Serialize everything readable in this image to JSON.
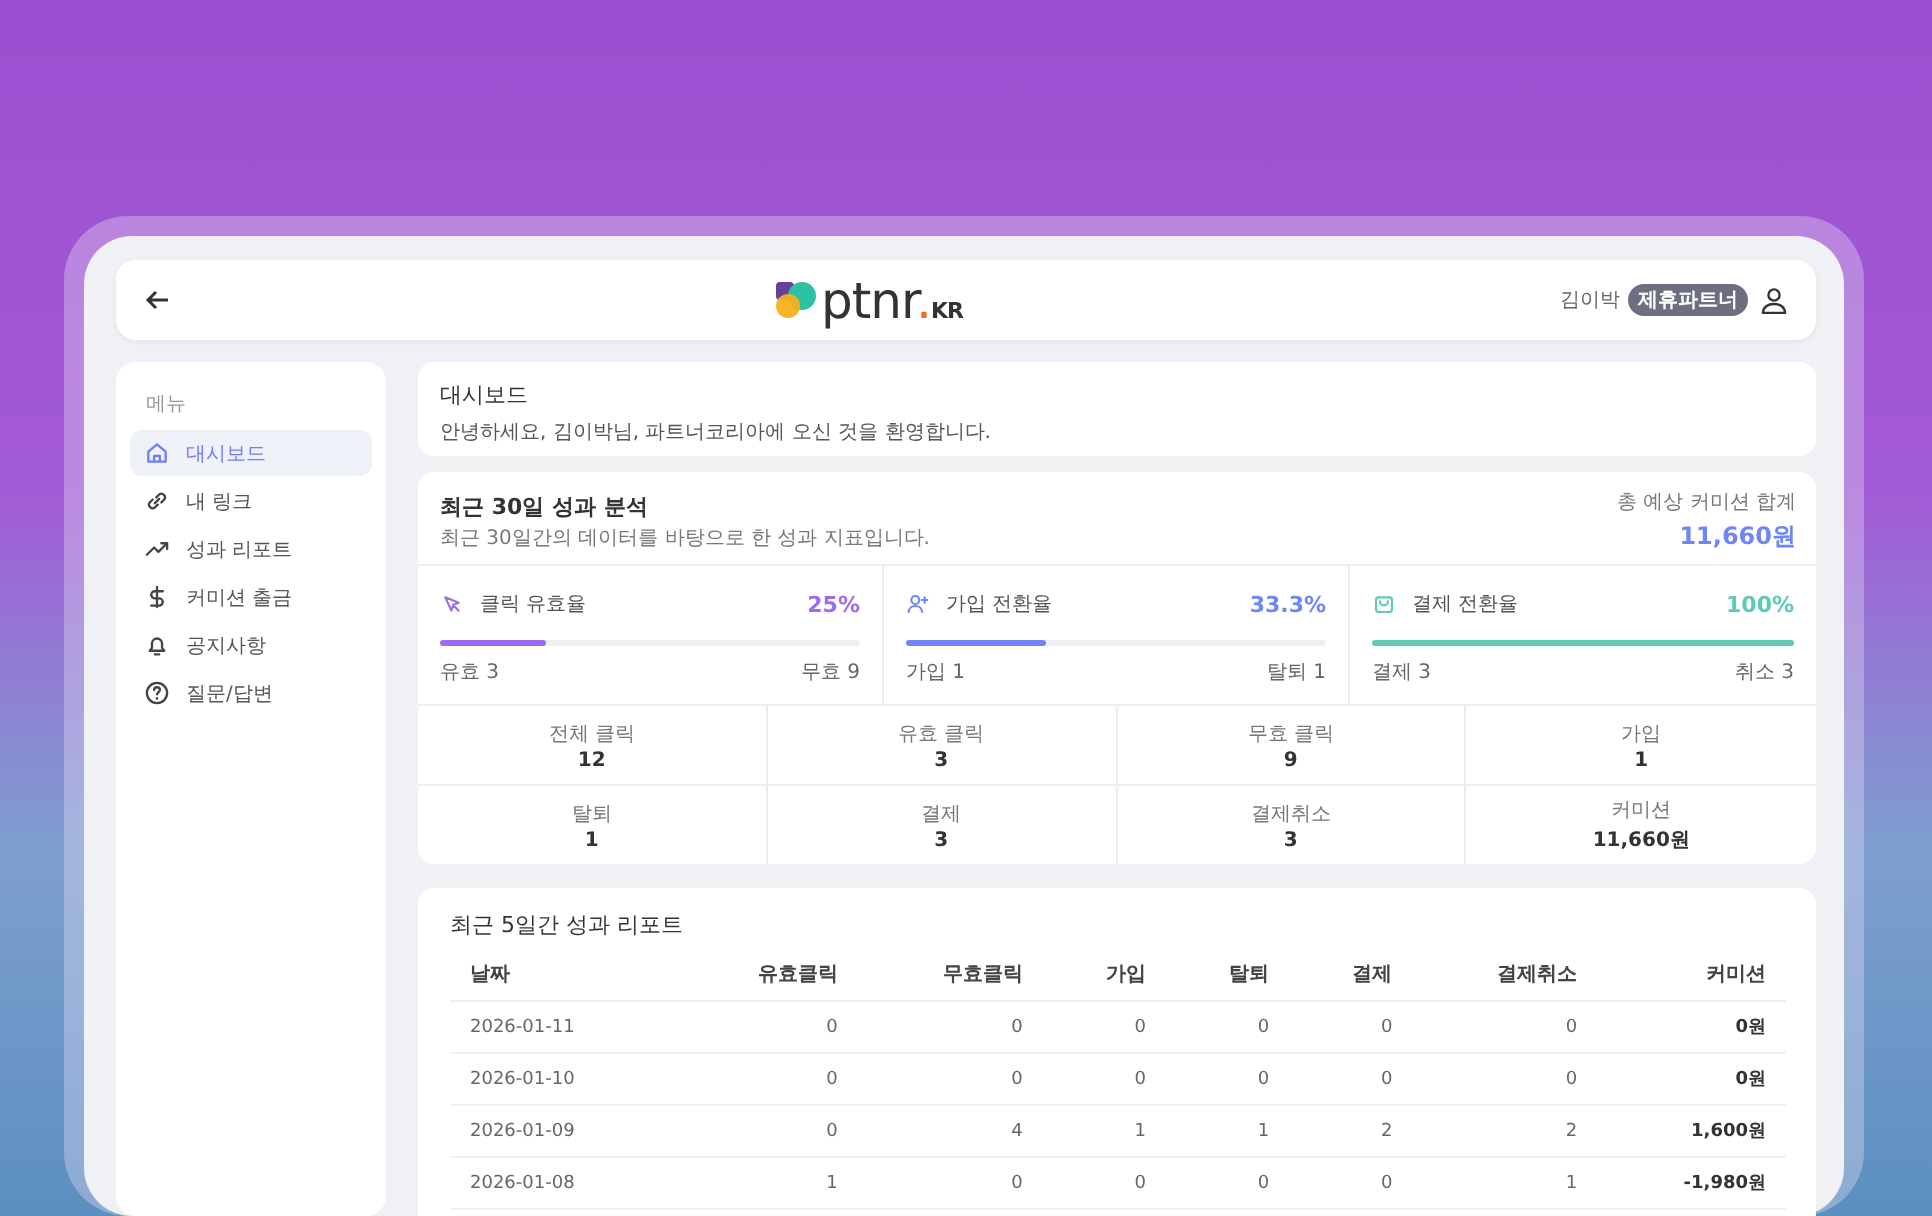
{
  "header": {
    "logo": {
      "name": "ptnr",
      "dot": ".",
      "suffix": "KR"
    },
    "user_name": "김이박",
    "badge": "제휴파트너"
  },
  "sidebar": {
    "title": "메뉴",
    "items": [
      {
        "label": "대시보드",
        "selected": true
      },
      {
        "label": "내 링크",
        "selected": false
      },
      {
        "label": "성과 리포트",
        "selected": false
      },
      {
        "label": "커미션 출금",
        "selected": false
      },
      {
        "label": "공지사항",
        "selected": false
      },
      {
        "label": "질문/답변",
        "selected": false
      }
    ]
  },
  "welcome": {
    "title": "대시보드",
    "message": "안녕하세요, 김이박님, 파트너코리아에 오신 것을 환영합니다."
  },
  "analysis": {
    "title": "최근 30일 성과 분석",
    "subtitle": "최근 30일간의 데이터를 바탕으로 한 성과 지표입니다.",
    "total_label": "총 예상 커미션 합계",
    "total_value": "11,660원",
    "metrics": [
      {
        "kind": "cursor",
        "label": "클릭 유효율",
        "value": "25%",
        "level": 0.25,
        "color": "#9b6cf0",
        "left": "유효 3",
        "right": "무효 9"
      },
      {
        "kind": "user",
        "label": "가입 전환율",
        "value": "33.3%",
        "level": 0.333,
        "color": "#6f86f7",
        "left": "가입 1",
        "right": "탈퇴 1"
      },
      {
        "kind": "bag",
        "label": "결제 전환율",
        "value": "100%",
        "level": 1,
        "color": "#5fc9b8",
        "left": "결제 3",
        "right": "취소 3"
      }
    ],
    "stats": [
      {
        "label": "전체 클릭",
        "value": "12"
      },
      {
        "label": "유효 클릭",
        "value": "3"
      },
      {
        "label": "무효 클릭",
        "value": "9"
      },
      {
        "label": "가입",
        "value": "1"
      },
      {
        "label": "탈퇴",
        "value": "1"
      },
      {
        "label": "결제",
        "value": "3"
      },
      {
        "label": "결제취소",
        "value": "3"
      },
      {
        "label": "커미션",
        "value": "11,660원"
      }
    ]
  },
  "report": {
    "title": "최근 5일간 성과 리포트",
    "columns": [
      "날짜",
      "유효클릭",
      "무효클릭",
      "가입",
      "탈퇴",
      "결제",
      "결제취소",
      "커미션"
    ],
    "rows": [
      [
        "2026-01-11",
        "0",
        "0",
        "0",
        "0",
        "0",
        "0",
        "0원"
      ],
      [
        "2026-01-10",
        "0",
        "0",
        "0",
        "0",
        "0",
        "0",
        "0원"
      ],
      [
        "2026-01-09",
        "0",
        "4",
        "1",
        "1",
        "2",
        "2",
        "1,600원"
      ],
      [
        "2026-01-08",
        "1",
        "0",
        "0",
        "0",
        "0",
        "1",
        "-1,980원"
      ]
    ]
  }
}
